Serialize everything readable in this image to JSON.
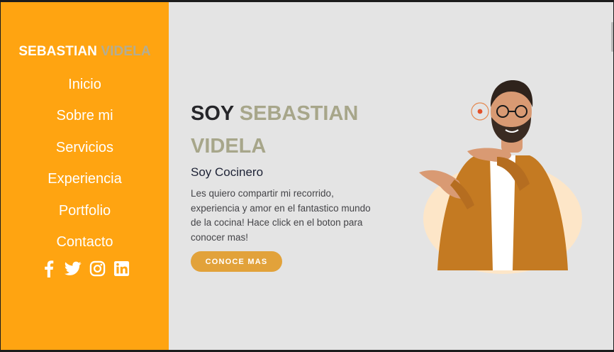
{
  "sidebar": {
    "brand_first": "SEBASTIAN",
    "brand_second": "VIDELA",
    "nav": [
      "Inicio",
      "Sobre mi",
      "Servicios",
      "Experiencia",
      "Portfolio",
      "Contacto"
    ],
    "socials": [
      "facebook-icon",
      "twitter-icon",
      "instagram-icon",
      "linkedin-icon"
    ]
  },
  "hero": {
    "title_prefix": "SOY",
    "title_name": "SEBASTIAN VIDELA",
    "subtitle": "Soy Cocinero",
    "description": "Les quiero compartir mi recorrido, experiencia y amor en el fantastico mundo de la cocina! Hace click en el boton para conocer mas!",
    "cta_label": "CONOCE MAS"
  },
  "colors": {
    "sidebar_bg": "#ffa411",
    "accent_gray": "#b3ad93",
    "cta_bg": "#e2a23a",
    "page_bg": "#e4e4e4"
  }
}
